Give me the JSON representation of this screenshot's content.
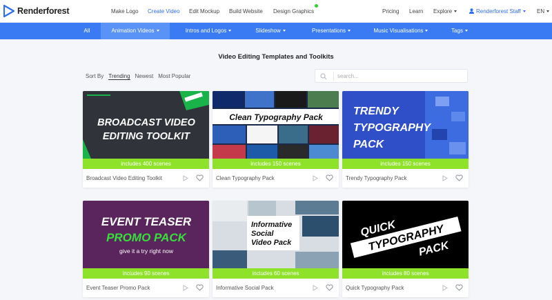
{
  "brand": {
    "name": "Renderforest",
    "accent": "#3a7bf4",
    "green": "#8ee32a"
  },
  "topnav": {
    "items": [
      "Make Logo",
      "Create Video",
      "Edit Mockup",
      "Build Website",
      "Design Graphics"
    ],
    "active_index": 1,
    "right": {
      "pricing": "Pricing",
      "learn": "Learn",
      "explore": "Explore",
      "user": "Renderforest Staff",
      "lang": "EN"
    }
  },
  "categories": [
    "All",
    "Animation Videos",
    "Intros and Logos",
    "Slideshow",
    "Presentations",
    "Music Visualisations",
    "Tags"
  ],
  "page": {
    "title": "Video Editing Templates and Toolkits",
    "sort_label": "Sort By",
    "sort_options": [
      "Trending",
      "Newest",
      "Most Popular"
    ],
    "search_placeholder": "search..."
  },
  "cards": [
    {
      "title": "Broadcast Video Editing Toolkit",
      "scenes": "includes 400 scenes",
      "thumb_lines": [
        "BROADCAST VIDEO",
        "EDITING TOOLKIT"
      ]
    },
    {
      "title": "Clean Typography Pack",
      "scenes": "includes 150 scenes",
      "thumb_lines": [
        "Clean Typography Pack"
      ]
    },
    {
      "title": "Trendy Typography Pack",
      "scenes": "includes 150 scenes",
      "thumb_lines": [
        "TRENDY",
        "TYPOGRAPHY",
        "PACK"
      ]
    },
    {
      "title": "Event Teaser Promo Pack",
      "scenes": "includes 90 scenes",
      "thumb_lines": [
        "EVENT TEASER",
        "PROMO PACK",
        "give it a try right now"
      ]
    },
    {
      "title": "Informative Social Pack",
      "scenes": "includes 60 scenes",
      "thumb_lines": [
        "Informative",
        "Social",
        "Video Pack"
      ]
    },
    {
      "title": "Quick Typography Pack",
      "scenes": "includes 80 scenes",
      "thumb_lines": [
        "QUICK",
        "TYPOGRAPHY",
        "PACK"
      ]
    }
  ],
  "icons": {
    "play": "play-icon",
    "heart": "heart-icon",
    "search": "search-icon",
    "user": "user-icon"
  }
}
